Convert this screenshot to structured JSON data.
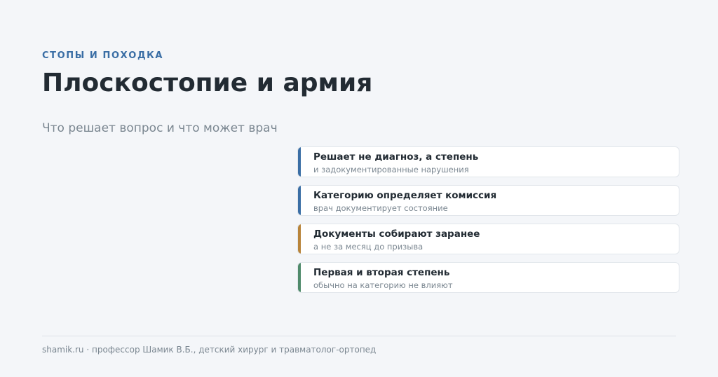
{
  "header": {
    "kicker": "СТОПЫ И ПОХОДКА",
    "title": "Плоскостопие и армия",
    "subtitle": "Что решает вопрос и что может врач"
  },
  "cards": [
    {
      "title": "Решает не диагноз, а степень",
      "desc": "и задокументированные нарушения",
      "accent": "#3a6ea5"
    },
    {
      "title": "Категорию определяет комиссия",
      "desc": "врач документирует состояние",
      "accent": "#3a6ea5"
    },
    {
      "title": "Документы собирают заранее",
      "desc": "а не за месяц до призыва",
      "accent": "#b8843a"
    },
    {
      "title": "Первая и вторая степень",
      "desc": "обычно на категорию не влияют",
      "accent": "#4f8a6b"
    }
  ],
  "footer": {
    "text": "shamik.ru · профессор Шамик В.Б., детский хирург и травматолог-ортопед"
  }
}
